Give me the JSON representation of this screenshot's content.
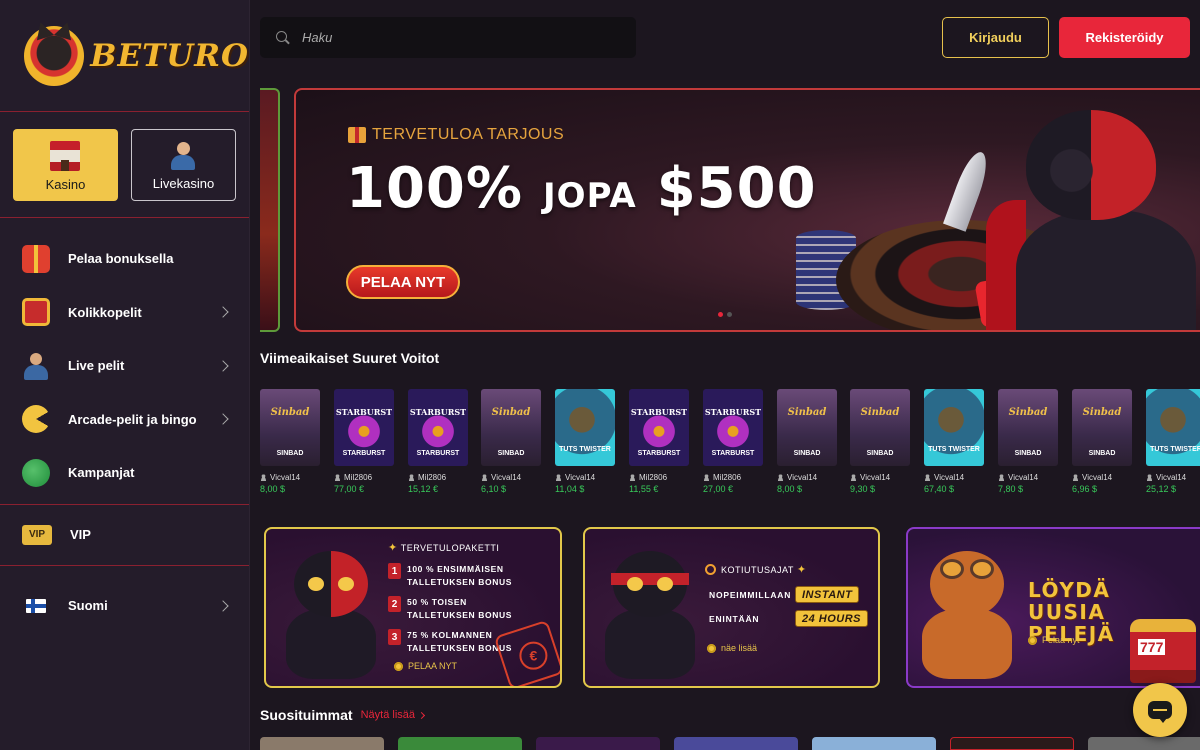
{
  "brand": {
    "name": "BETURO"
  },
  "mode_tabs": [
    {
      "label": "Kasino",
      "icon": "casino-building-icon",
      "active": true
    },
    {
      "label": "Livekasino",
      "icon": "live-dealer-icon",
      "active": false
    }
  ],
  "nav": {
    "items": [
      {
        "label": "Pelaa bonuksella",
        "icon": "gift-icon",
        "has_submenu": false
      },
      {
        "label": "Kolikkopelit",
        "icon": "slot-machine-icon",
        "has_submenu": true
      },
      {
        "label": "Live pelit",
        "icon": "dealer-icon",
        "has_submenu": true
      },
      {
        "label": "Arcade-pelit ja bingo",
        "icon": "arcade-icon",
        "has_submenu": true
      },
      {
        "label": "Kampanjat",
        "icon": "money-bag-icon",
        "has_submenu": false
      }
    ],
    "vip": {
      "label": "VIP",
      "icon_text": "VIP"
    },
    "language": {
      "label": "Suomi",
      "icon": "finland-flag-icon"
    }
  },
  "header": {
    "search_placeholder": "Haku",
    "login_label": "Kirjaudu",
    "register_label": "Rekisteröidy"
  },
  "hero": {
    "kicker": "TERVETULOA TARJOUS",
    "headline_percent": "100%",
    "headline_mid": "JOPA",
    "headline_amount": "$500",
    "cta": "PELAA NYT",
    "slides": 2,
    "active_slide": 1
  },
  "recent_wins": {
    "title": "Viimeaikaiset Suuret Voitot",
    "items": [
      {
        "game": "SINBAD",
        "logo": "Sinbad",
        "theme": "sinbad",
        "user": "Vicval14",
        "amount": "8,00 $"
      },
      {
        "game": "STARBURST",
        "logo": "STARBURST",
        "theme": "star",
        "user": "Mil2806",
        "amount": "77,00 €"
      },
      {
        "game": "STARBURST",
        "logo": "STARBURST",
        "theme": "star",
        "user": "Mil2806",
        "amount": "15,12 €"
      },
      {
        "game": "SINBAD",
        "logo": "Sinbad",
        "theme": "sinbad",
        "user": "Vicval14",
        "amount": "6,10 $"
      },
      {
        "game": "TUTS TWISTER",
        "logo": "",
        "theme": "tuts",
        "user": "Vicval14",
        "amount": "11,04 $"
      },
      {
        "game": "STARBURST",
        "logo": "STARBURST",
        "theme": "star",
        "user": "Mil2806",
        "amount": "11,55 €"
      },
      {
        "game": "STARBURST",
        "logo": "STARBURST",
        "theme": "star",
        "user": "Mil2806",
        "amount": "27,00 €"
      },
      {
        "game": "SINBAD",
        "logo": "Sinbad",
        "theme": "sinbad",
        "user": "Vicval14",
        "amount": "8,00 $"
      },
      {
        "game": "SINBAD",
        "logo": "Sinbad",
        "theme": "sinbad",
        "user": "Vicval14",
        "amount": "9,30 $"
      },
      {
        "game": "TUTS TWISTER",
        "logo": "",
        "theme": "tuts",
        "user": "Vicval14",
        "amount": "67,40 $"
      },
      {
        "game": "SINBAD",
        "logo": "Sinbad",
        "theme": "sinbad",
        "user": "Vicval14",
        "amount": "7,80 $"
      },
      {
        "game": "SINBAD",
        "logo": "Sinbad",
        "theme": "sinbad",
        "user": "Vicval14",
        "amount": "6,96 $"
      },
      {
        "game": "TUTS TWISTER",
        "logo": "",
        "theme": "tuts",
        "user": "Vicval14",
        "amount": "25,12 $"
      }
    ]
  },
  "promos": {
    "welcome": {
      "kicker": "TERVETULOPAKETTI",
      "steps": [
        {
          "num": "1",
          "text": "100 % ENSIMMÄISEN TALLETUKSEN BONUS"
        },
        {
          "num": "2",
          "text": "50 % TOISEN TALLETUKSEN BONUS"
        },
        {
          "num": "3",
          "text": "75 % KOLMANNEN TALLETUKSEN BONUS"
        }
      ],
      "link": "PELAA NYT"
    },
    "payouts": {
      "kicker": "KOTIUTUSAJAT",
      "rows": [
        {
          "key": "NOPEIMMILLAAN",
          "value": "INSTANT"
        },
        {
          "key": "ENINTÄÄN",
          "value": "24 HOURS"
        }
      ],
      "link": "näe lisää"
    },
    "discover": {
      "title_line1": "LÖYDÄ",
      "title_line2": "UUSIA PELEJÄ",
      "link": "Pelaa nyt"
    }
  },
  "popular": {
    "title": "Suosituimmat",
    "see_more": "Näytä lisää"
  },
  "colors": {
    "accent_gold": "#f1c64a",
    "accent_red": "#e8263a",
    "win_green": "#38c95a",
    "sidebar_bg": "#241c2a",
    "page_bg": "#1c161f"
  }
}
